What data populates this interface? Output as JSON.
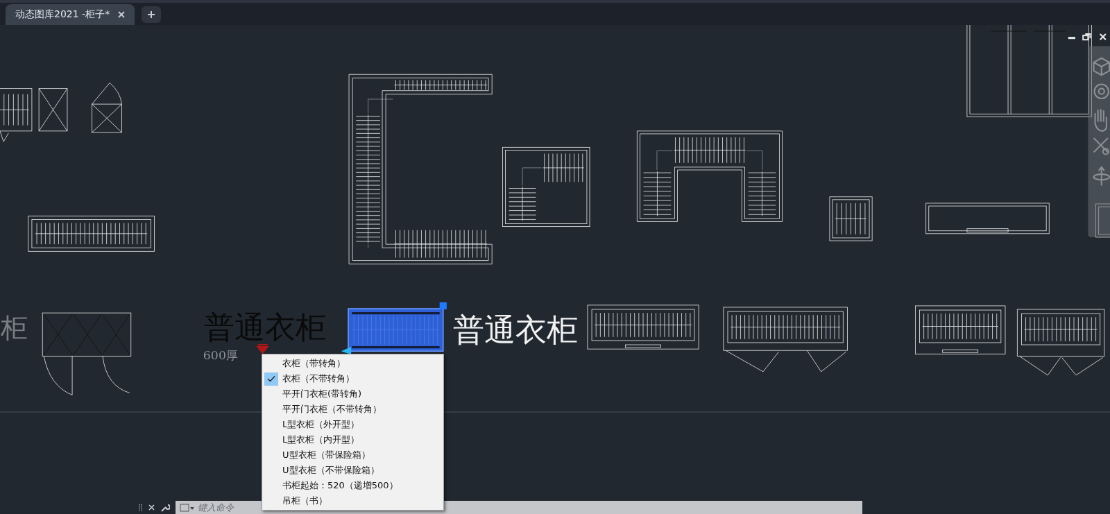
{
  "tabs": [
    {
      "label": "动态图库2021 -柜子*",
      "selected": true
    }
  ],
  "canvas_texts": [
    {
      "text": "柜",
      "kind": "faded"
    },
    {
      "text": "普通衣柜",
      "kind": "dark-large"
    },
    {
      "text": "600厚",
      "kind": "dark-small"
    },
    {
      "text": "普通衣柜",
      "kind": "light-large"
    }
  ],
  "context_menu": {
    "items": [
      {
        "label": "衣柜（带转角）",
        "checked": false
      },
      {
        "label": "衣柜（不带转角）",
        "checked": true
      },
      {
        "label": "平开门衣柜(带转角)",
        "checked": false
      },
      {
        "label": "平开门衣柜（不带转角）",
        "checked": false
      },
      {
        "label": "L型衣柜（外开型）",
        "checked": false
      },
      {
        "label": "L型衣柜（内开型）",
        "checked": false
      },
      {
        "label": "U型衣柜（带保险箱）",
        "checked": false
      },
      {
        "label": "U型衣柜（不带保险箱）",
        "checked": false
      },
      {
        "label": "书柜起始：520（递增500）",
        "checked": false
      },
      {
        "label": "吊柜（书）",
        "checked": false
      }
    ]
  },
  "command_line": {
    "placeholder": "键入命令"
  }
}
